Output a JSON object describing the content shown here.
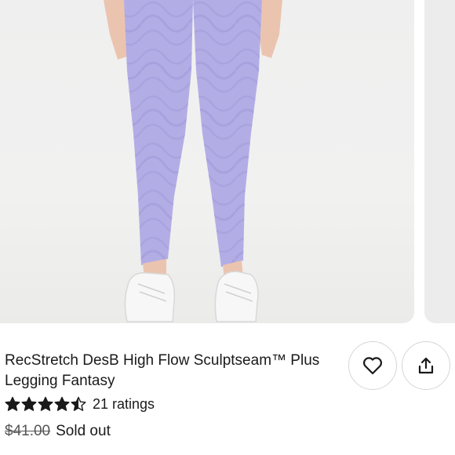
{
  "product": {
    "title": "RecStretch DesB High Flow Sculptseam™ Plus Legging Fantasy",
    "rating": {
      "stars": 4.5,
      "max_stars": 5,
      "count_label": "21 ratings"
    },
    "price": {
      "original": "$41.00",
      "status": "Sold out"
    }
  },
  "actions": {
    "favorite_icon": "heart-icon",
    "share_icon": "share-icon"
  },
  "colors": {
    "legging": "#b3ade6",
    "background": "#efefef",
    "text": "#1a1a1a"
  }
}
